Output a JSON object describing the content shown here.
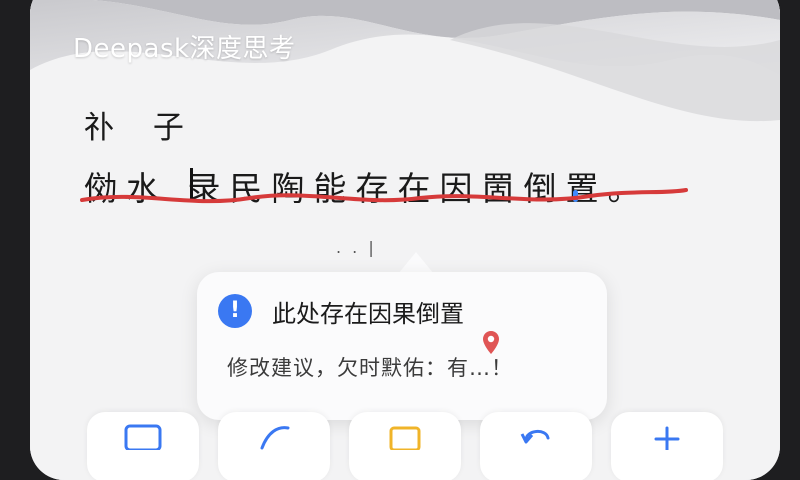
{
  "app": {
    "title": "Deepask深度思考"
  },
  "document": {
    "line1": "䃼 子",
    "line2": "俲水 录民陶能存在因䍛倒置。",
    "ellipsis": ". . |"
  },
  "popup": {
    "title": "此处存在因果倒置",
    "suggestion": "修改建议，欠时默佑：有…！",
    "icon": "alert-icon",
    "accent_color": "#3a78f2"
  },
  "dock": {
    "items": [
      {
        "icon": "image-icon"
      },
      {
        "icon": "brush-icon"
      },
      {
        "icon": "note-icon"
      },
      {
        "icon": "undo-icon"
      },
      {
        "icon": "add-icon"
      }
    ]
  },
  "colors": {
    "underline": "#d63a3a",
    "cursor_dot": "#3d8bff"
  }
}
